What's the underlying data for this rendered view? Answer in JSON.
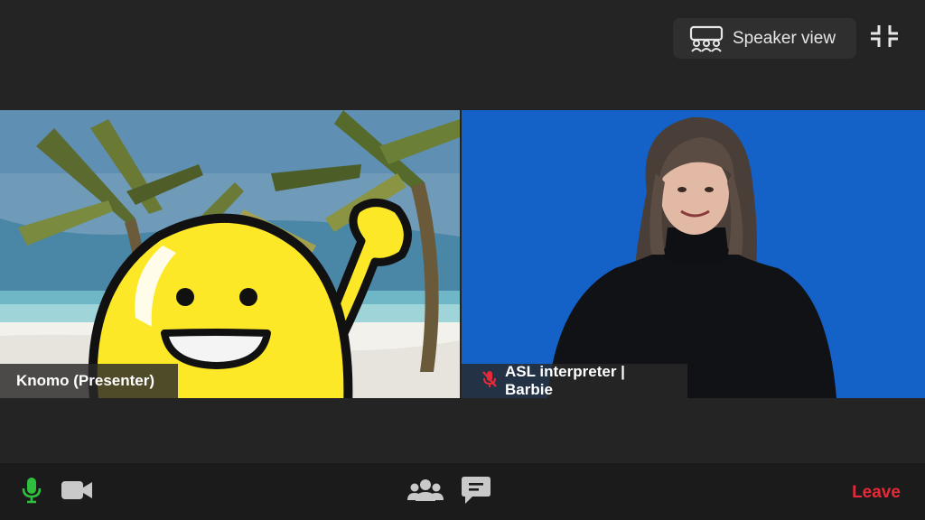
{
  "header": {
    "speaker_view_label": "Speaker view",
    "speaker_view_icon": "speaker-view-grid-icon",
    "exit_fullscreen_icon": "exit-fullscreen-icon"
  },
  "participants": [
    {
      "name": "Knomo (Presenter)",
      "muted": false,
      "avatar": "yellow-cartoon-character"
    },
    {
      "name": "ASL interpreter | Barbie",
      "muted": true,
      "muted_icon": "muted-microphone-icon"
    }
  ],
  "toolbar": {
    "mic_icon": "microphone-icon",
    "camera_icon": "video-camera-icon",
    "participants_icon": "participants-icon",
    "chat_icon": "chat-icon",
    "leave_label": "Leave"
  },
  "colors": {
    "background": "#242424",
    "toolbar": "#1b1b1b",
    "mic_active": "#2fbf3f",
    "leave": "#e8293a",
    "interpreter_bg": "#1461c8",
    "avatar_yellow": "#fde827"
  }
}
